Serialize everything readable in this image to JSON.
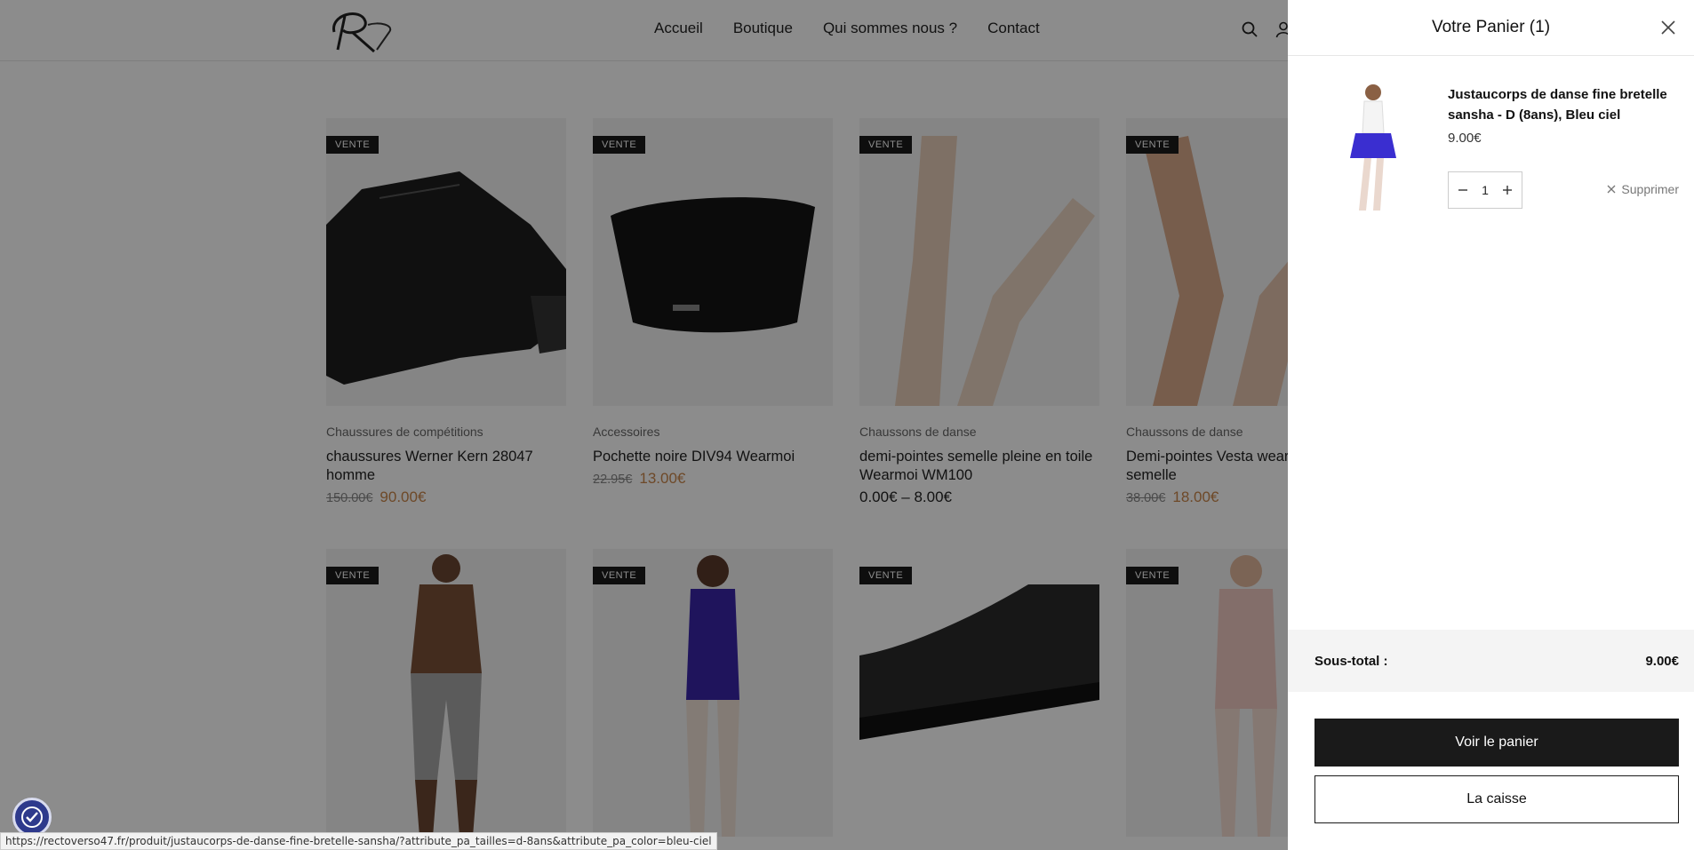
{
  "nav": {
    "items": [
      "Accueil",
      "Boutique",
      "Qui sommes nous ?",
      "Contact"
    ]
  },
  "products": [
    {
      "badge": "VENTE",
      "category": "Chaussures de compétitions",
      "title": "chaussures Werner Kern 28047 homme",
      "old_price": "150.00€",
      "price": "90.00€"
    },
    {
      "badge": "VENTE",
      "category": "Accessoires",
      "title": "Pochette noire DIV94 Wearmoi",
      "old_price": "22.95€",
      "price": "13.00€"
    },
    {
      "badge": "VENTE",
      "category": "Chaussons de danse",
      "title": "demi-pointes semelle pleine en toile Wearmoi WM100",
      "price_range": "0.00€ – 8.00€"
    },
    {
      "badge": "VENTE",
      "category": "Chaussons de danse",
      "title": "Demi-pointes Vesta wearmoi semelle",
      "old_price": "38.00€",
      "price": "18.00€"
    },
    {
      "badge": "VENTE"
    },
    {
      "badge": "VENTE"
    },
    {
      "badge": "VENTE"
    },
    {
      "badge": "VENTE"
    }
  ],
  "cart": {
    "title": "Votre Panier (1)",
    "item": {
      "name": "Justaucorps de danse fine bretelle sansha - D (8ans), Bleu ciel",
      "price": "9.00€",
      "quantity": "1",
      "remove_label": "Supprimer"
    },
    "subtotal_label": "Sous-total :",
    "subtotal_value": "9.00€",
    "view_cart_label": "Voir le panier",
    "checkout_label": "La caisse"
  },
  "status_bar": {
    "url": "https://rectoverso47.fr/produit/justaucorps-de-danse-fine-bretelle-sansha/?attribute_pa_tailles=d-8ans&attribute_pa_color=bleu-ciel"
  }
}
